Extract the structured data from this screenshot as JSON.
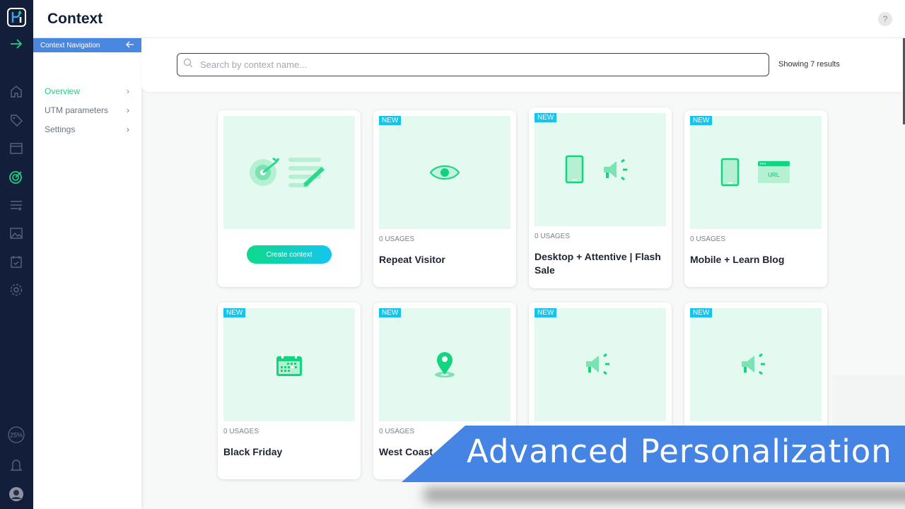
{
  "header": {
    "title": "Context",
    "help_label": "?"
  },
  "rail": {
    "items": [
      "expand",
      "home",
      "tags",
      "layout",
      "context",
      "lists",
      "images",
      "calendar",
      "settings"
    ],
    "progress_label": "25%"
  },
  "subnav": {
    "title": "Context Navigation",
    "items": [
      {
        "label": "Overview",
        "active": true
      },
      {
        "label": "UTM parameters",
        "active": false
      },
      {
        "label": "Settings",
        "active": false
      }
    ]
  },
  "search": {
    "placeholder": "Search by context name...",
    "value": "",
    "results_text": "Showing 7 results"
  },
  "create_card": {
    "button_label": "Create context"
  },
  "cards": [
    {
      "badge": "NEW",
      "usages": "0 USAGES",
      "name": "Repeat Visitor",
      "icon": "eye-icon"
    },
    {
      "badge": "NEW",
      "usages": "0 USAGES",
      "name": "Desktop + Attentive | Flash Sale",
      "icon": "phone-megaphone-icon"
    },
    {
      "badge": "NEW",
      "usages": "0 USAGES",
      "name": "Mobile + Learn Blog",
      "icon": "phone-url-icon",
      "url_label": "URL"
    },
    {
      "badge": "NEW",
      "usages": "0 USAGES",
      "name": "Black Friday",
      "icon": "calendar-icon"
    },
    {
      "badge": "NEW",
      "usages": "0 USAGES",
      "name": "West Coast",
      "icon": "location-pin-icon"
    },
    {
      "badge": "NEW",
      "icon": "megaphone-icon"
    },
    {
      "badge": "NEW",
      "icon": "megaphone-icon"
    }
  ],
  "banner": {
    "text": "Advanced Personalization",
    "color": "#4584e2"
  },
  "colors": {
    "accent": "#1fcf82",
    "rail": "#131f3a",
    "badge": "#15c3ed"
  }
}
